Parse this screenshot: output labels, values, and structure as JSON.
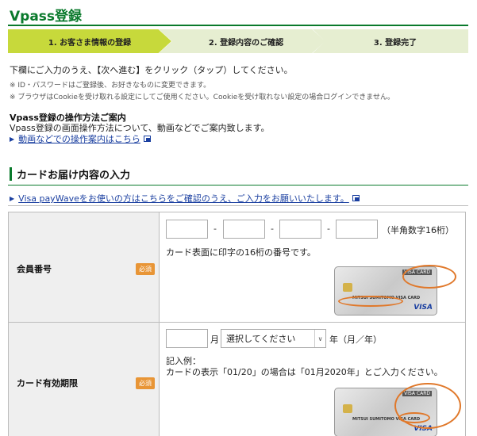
{
  "page": {
    "title": "Vpass登録"
  },
  "steps": [
    {
      "label": "1. お客さま情報の登録"
    },
    {
      "label": "2. 登録内容のご確認"
    },
    {
      "label": "3. 登録完了"
    }
  ],
  "intro": {
    "text": "下欄にご入力のうえ、【次へ進む】をクリック（タップ）してください。",
    "note1": "※ ID・パスワードはご登録後、お好きなものに変更できます。",
    "note2": "※ ブラウザはCookieを受け取れる設定にしてご使用ください。Cookieを受け取れない設定の場合ログインできません。"
  },
  "guide": {
    "heading": "Vpass登録の操作方法ご案内",
    "text": "Vpass登録の画面操作方法について、動画などでご案内致します。",
    "link": "動画などでの操作案内はこちら"
  },
  "section": {
    "title": "カードお届け内容の入力",
    "visa_link": "Visa payWaveをお使いの方はこちらをご確認のうえ、ご入力をお願いいたします。"
  },
  "fields": {
    "card_number": {
      "label": "会員番号",
      "required": "必須",
      "dash": "-",
      "digits_note": "（半角数字16桁）",
      "hint": "カード表面に印字の16桁の番号です。"
    },
    "expiry": {
      "label": "カード有効期限",
      "required": "必須",
      "month_unit": "月",
      "year_placeholder": "選択してください",
      "year_unit": "年（月／年）",
      "example_heading": "記入例：",
      "example_text": "カードの表示「01/20」の場合は「01月2020年」とご入力ください。"
    }
  },
  "card_image": {
    "brand": "MITSUI SUMITOMO VISA CARD",
    "visa_card_label": "VISA CARD",
    "logo": "VISA"
  },
  "colors": {
    "accent_green": "#0a7a2c",
    "active_step": "#c7d93b",
    "inactive_step": "#e6eed1",
    "required_badge": "#e89536",
    "link": "#1a3fa0",
    "highlight": "#e0782a"
  }
}
